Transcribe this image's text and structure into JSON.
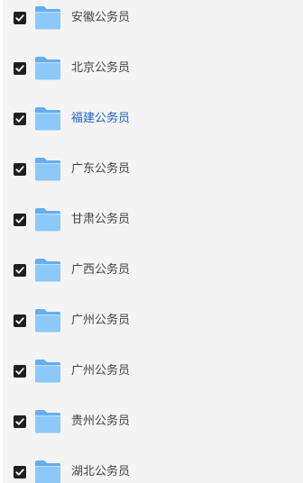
{
  "folders": [
    {
      "name": "安徽公务员",
      "checked": true
    },
    {
      "name": "北京公务员",
      "checked": true
    },
    {
      "name": "福建公务员",
      "checked": true,
      "highlighted": true
    },
    {
      "name": "广东公务员",
      "checked": true
    },
    {
      "name": "甘肃公务员",
      "checked": true
    },
    {
      "name": "广西公务员",
      "checked": true
    },
    {
      "name": "广州公务员",
      "checked": true
    },
    {
      "name": "广州公务员",
      "checked": true
    },
    {
      "name": "贵州公务员",
      "checked": true
    },
    {
      "name": "湖北公务员",
      "checked": true
    }
  ],
  "colors": {
    "background": "#f4f4f5",
    "checkbox": "#1f1f1f",
    "label": "#444444",
    "highlight_label": "#1f5fc9",
    "folder_front": "#8cc8f8",
    "folder_back": "#64aef2"
  },
  "icons": {
    "checkbox": "checkmark-icon",
    "folder": "folder-icon"
  }
}
